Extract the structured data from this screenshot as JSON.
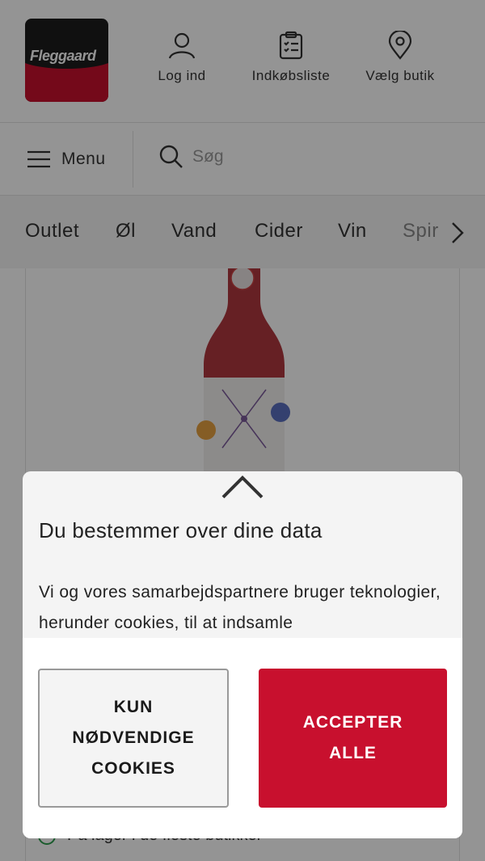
{
  "header": {
    "brand": "Fleggaard",
    "login_label": "Log ind",
    "shopping_list_label": "Indkøbsliste",
    "store_label": "Vælg butik"
  },
  "menubar": {
    "menu_label": "Menu",
    "search_placeholder": "Søg"
  },
  "categories": [
    "Outlet",
    "Øl",
    "Vand",
    "Cider",
    "Vin",
    "Spir"
  ],
  "product": {
    "stock_text": "På lager i de fleste butikker"
  },
  "cookie_dialog": {
    "title": "Du bestemmer over dine data",
    "text": "Vi og vores samarbejdspartnere bruger teknologier, herunder cookies, til at indsamle",
    "necessary_label": "KUN NØDVENDIGE COOKIES",
    "accept_label": "ACCEPTER ALLE"
  },
  "colors": {
    "brand_red": "#c8102e",
    "overlay": "rgba(0,0,0,0.42)"
  }
}
